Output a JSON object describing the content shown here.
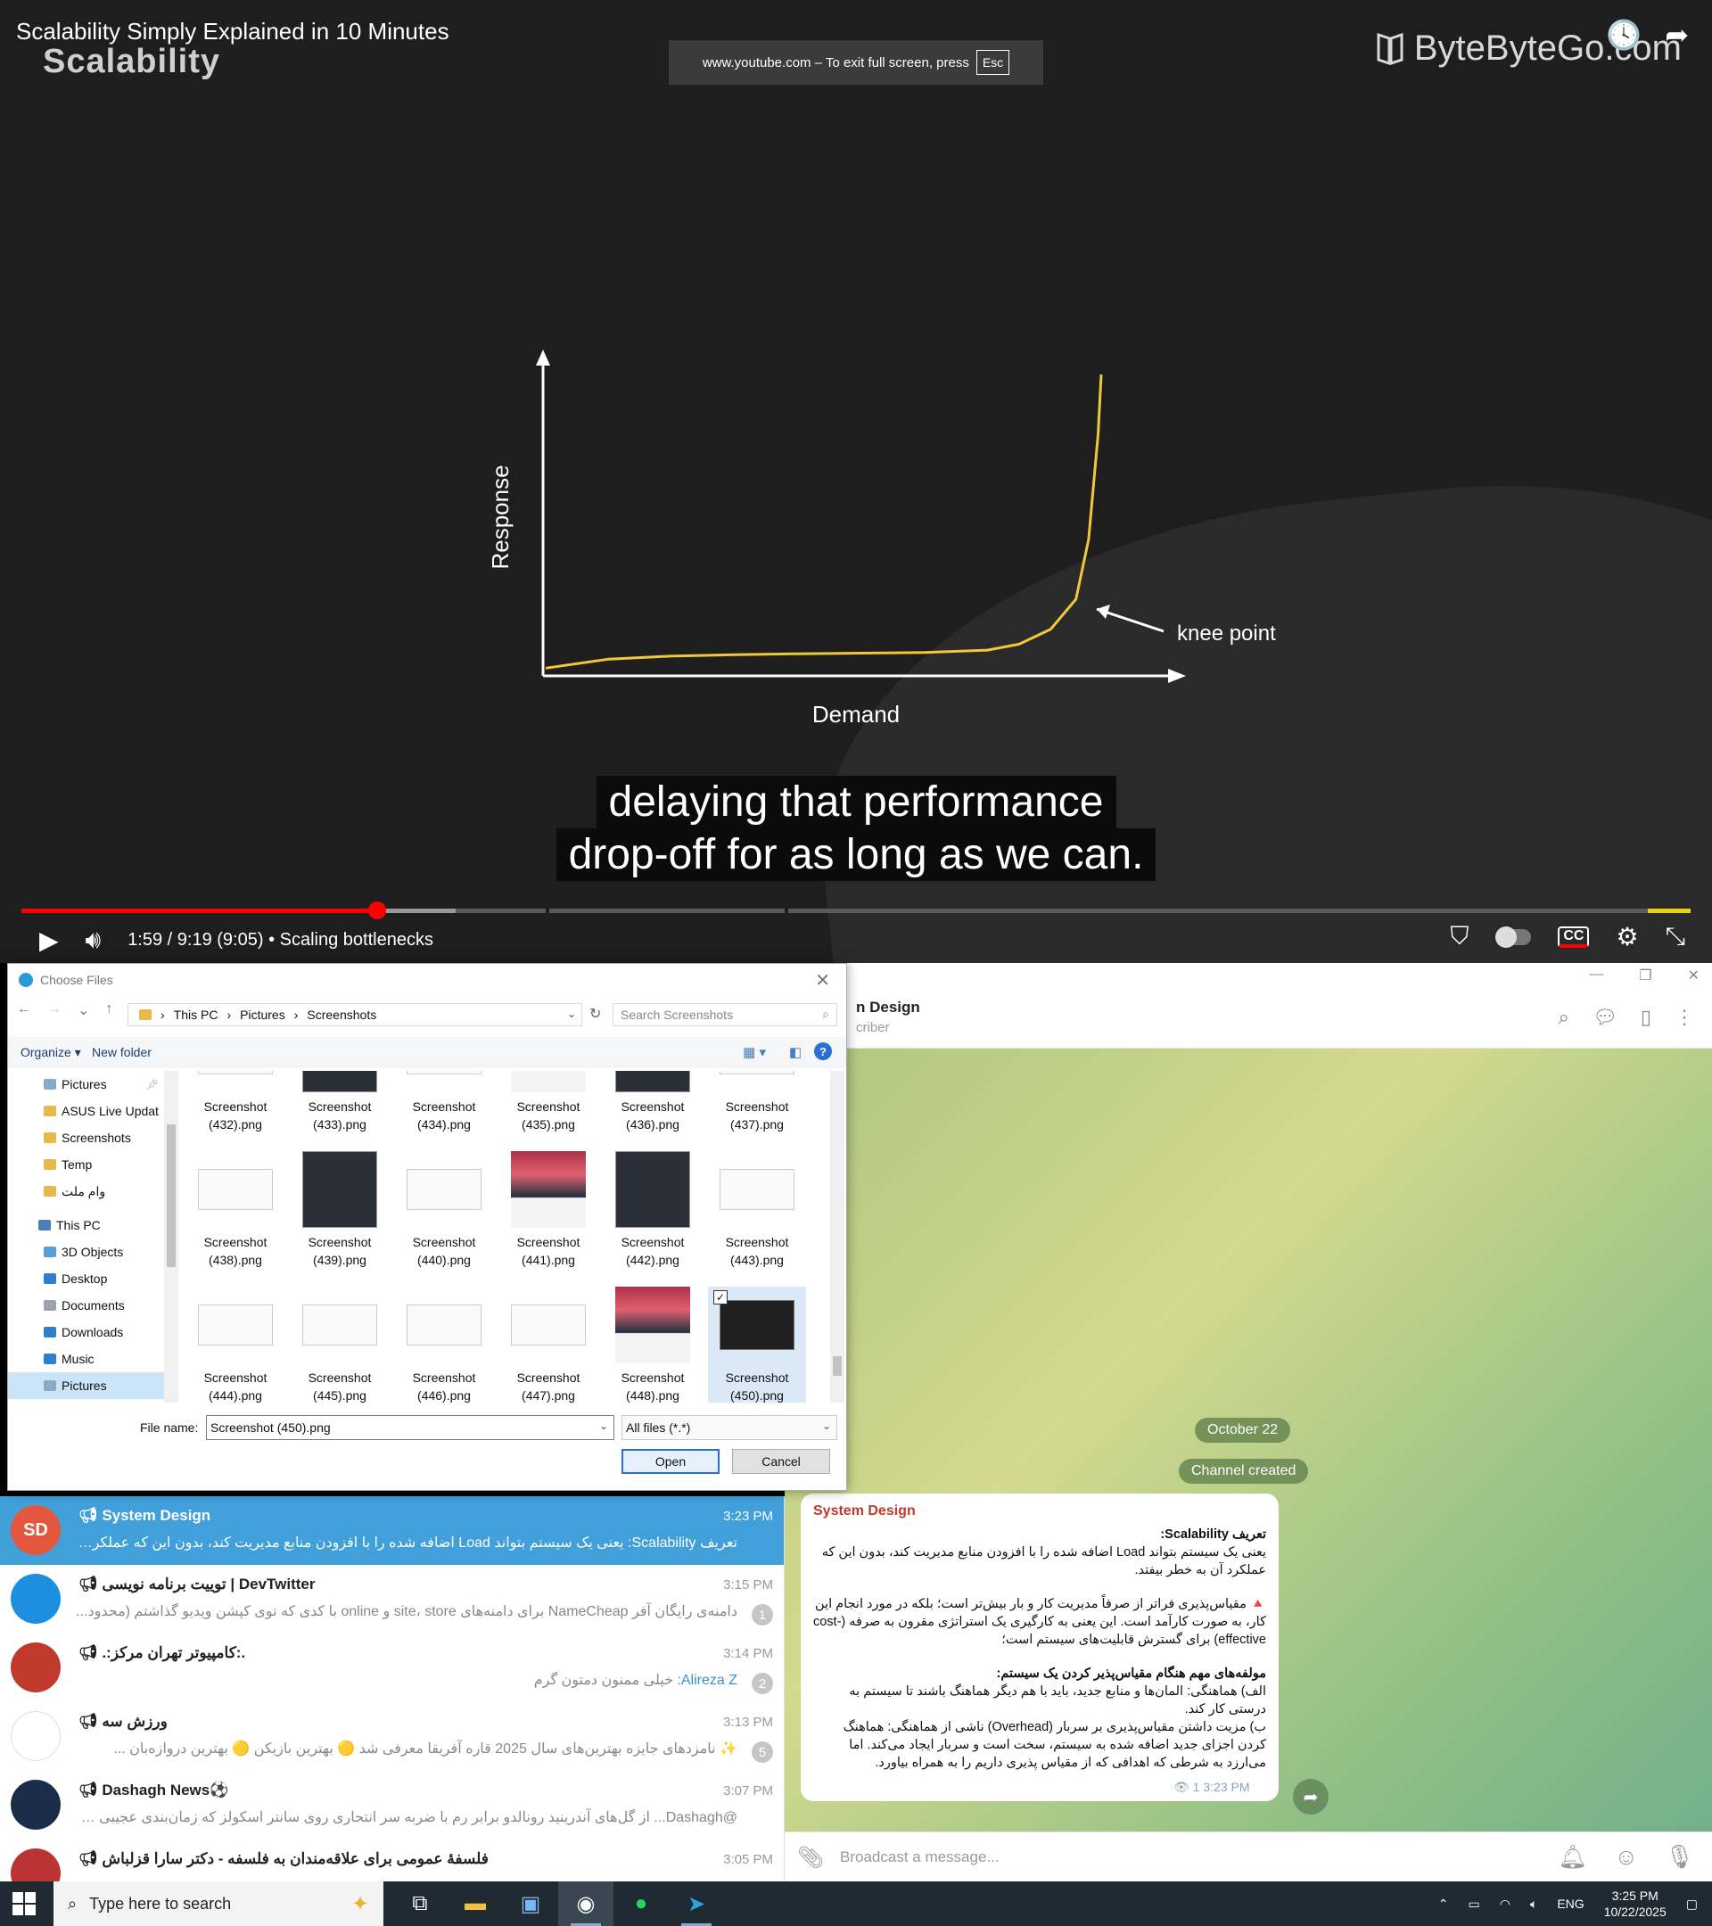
{
  "video": {
    "title": "Scalability Simply Explained in 10 Minutes",
    "slide_label": "Scalability",
    "fullscreen_notice": "www.youtube.com – To exit full screen, press",
    "fullscreen_key": "Esc",
    "brand": "ByteByteGo.com",
    "caption_line1": "delaying that performance",
    "caption_line2": "drop-off for as long as we can.",
    "time_text": "1:59 / 9:19 (9:05) • Scaling bottlenecks",
    "progress_fraction": 0.213,
    "buffered_fraction": 0.26
  },
  "chart_data": {
    "type": "line",
    "title": "",
    "xlabel": "Demand",
    "ylabel": "Response",
    "annotation": "knee point",
    "series": [
      {
        "x": [
          0,
          0.1,
          0.2,
          0.3,
          0.4,
          0.5,
          0.6,
          0.7,
          0.75,
          0.8,
          0.84,
          0.86,
          0.875,
          0.88
        ],
        "y": [
          0.02,
          0.05,
          0.06,
          0.065,
          0.068,
          0.07,
          0.072,
          0.08,
          0.1,
          0.15,
          0.25,
          0.45,
          0.8,
          1.0
        ]
      }
    ],
    "line_color": "#f0c93a",
    "grid": false
  },
  "dialog": {
    "title": "Choose Files",
    "path": [
      "This PC",
      "Pictures",
      "Screenshots"
    ],
    "search_placeholder": "Search Screenshots",
    "organize_label": "Organize ▾",
    "new_folder_label": "New folder",
    "tree": [
      {
        "label": "Pictures",
        "type": "pinned"
      },
      {
        "label": "ASUS Live Updat",
        "type": "folder"
      },
      {
        "label": "Screenshots",
        "type": "folder"
      },
      {
        "label": "Temp",
        "type": "folder"
      },
      {
        "label": "وام ملت",
        "type": "folder"
      },
      {
        "label": "This PC",
        "type": "root"
      },
      {
        "label": "3D Objects",
        "type": "3d"
      },
      {
        "label": "Desktop",
        "type": "desktop"
      },
      {
        "label": "Documents",
        "type": "docs"
      },
      {
        "label": "Downloads",
        "type": "downloads"
      },
      {
        "label": "Music",
        "type": "music"
      },
      {
        "label": "Pictures",
        "type": "pictures"
      }
    ],
    "files": [
      "Screenshot (432).png",
      "Screenshot (433).png",
      "Screenshot (434).png",
      "Screenshot (435).png",
      "Screenshot (436).png",
      "Screenshot (437).png",
      "Screenshot (438).png",
      "Screenshot (439).png",
      "Screenshot (440).png",
      "Screenshot (441).png",
      "Screenshot (442).png",
      "Screenshot (443).png",
      "Screenshot (444).png",
      "Screenshot (445).png",
      "Screenshot (446).png",
      "Screenshot (447).png",
      "Screenshot (448).png",
      "Screenshot (450).png"
    ],
    "file_name_label": "File name:",
    "file_name_value": "Screenshot (450).png",
    "file_type": "All files (*.*)",
    "open_label": "Open",
    "cancel_label": "Cancel"
  },
  "telegram": {
    "header_name": "n Design",
    "header_sub": "criber",
    "date_pill": "October 22",
    "service_pill": "Channel created",
    "message": {
      "sender": "System Design",
      "heading": "تعریف Scalability:",
      "p1": "یعنی یک سیستم بتواند Load اضافه شده را با افزودن منابع مدیریت کند، بدون این که عملکرد آن به خطر بیفتد.",
      "p2": "🔺 مقیاس‌پذیری فراتر از صرفاً مدیریت کار و بار بیش‌تر است؛ بلکه در مورد انجام این کار، به صورت کارآمد است. این یعنی به کارگیری یک استراتژی مقرون به صرفه (cost-effective) برای گسترش قابلیت‌های سیستم‌ است؛",
      "heading2": "مولفه‌های مهم هنگام مقیاس‌پذیر کردن یک سیستم:",
      "p3": "الف) هماهنگی: المان‌ها و منابع جدید، باید با هم دیگر هماهنگ باشند تا سیستم به درستی کار کند.",
      "p4": "ب) مزیت داشتن مقیاس‌پذیری بر سربار (Overhead) ناشی از هماهنگی: هماهنگ کردن اجزای جدید اضافه شده به سیستم، سخت است و سربار ایجاد می‌کند. اما می‌ارزد به شرطی که اهدافی که از مقیاس پذیری داریم را به همراه بیاورد.",
      "views": "1",
      "time": "3:23 PM"
    },
    "composer_placeholder": "Broadcast a message...",
    "chats": [
      {
        "title": "System Design",
        "time": "3:23 PM",
        "preview": "تعریف Scalability: یعنی یک سیستم بتواند Load اضافه شده را با افزودن منابع مدیریت کند، بدون این که عملکرد آن به خط...",
        "avatar": "SD",
        "color": "#e4573f",
        "active": true,
        "badge": ""
      },
      {
        "title": "توییت برنامه نویسی | DevTwitter",
        "time": "3:15 PM",
        "preview": "دامنه‌ی رایگان آفر NameCheap برای دامنه‌های site، store و online با کدی که توی کپشن ویدیو گذاشتم (محدود...",
        "avatar": "",
        "color": "#1d8fe0",
        "active": false,
        "badge": "1"
      },
      {
        "title": ".:کامپیوتر تهران مرکز:.",
        "time": "3:14 PM",
        "preview": "خیلی ممنون دمتون گرم",
        "sender": "Alireza Z:",
        "avatar": "",
        "color": "#c0392b",
        "active": false,
        "badge": "2"
      },
      {
        "title": "ورزش سه",
        "time": "3:13 PM",
        "preview": "✨ نامزدهای جایزه بهترین‌های سال 2025 قاره آفریقا معرفی شد 🟡 بهترین بازیکن 🟡 بهترین دروازه‌بان ...",
        "avatar": "",
        "color": "#ffffff",
        "active": false,
        "badge": "5"
      },
      {
        "title": "Dashagh News⚽️",
        "time": "3:07 PM",
        "preview": "@Dashagh... از گل‌های آندرینید رونالدو برابر رم با ضربه سر انتحاری روی سانتر اسکولز که زمان‌بندی عجیبی داشت",
        "avatar": "",
        "color": "#1a2c4a",
        "active": false,
        "badge": ""
      },
      {
        "title": "فلسفهٔ عمومی برای علاقه‌مندان به فلسفه - دکتر سارا قزلباش",
        "time": "3:05 PM",
        "preview": "",
        "avatar": "",
        "color": "#b33",
        "active": false,
        "badge": ""
      }
    ]
  },
  "taskbar": {
    "search_placeholder": "Type here to search",
    "language": "ENG",
    "time": "3:25 PM",
    "date": "10/22/2025"
  }
}
